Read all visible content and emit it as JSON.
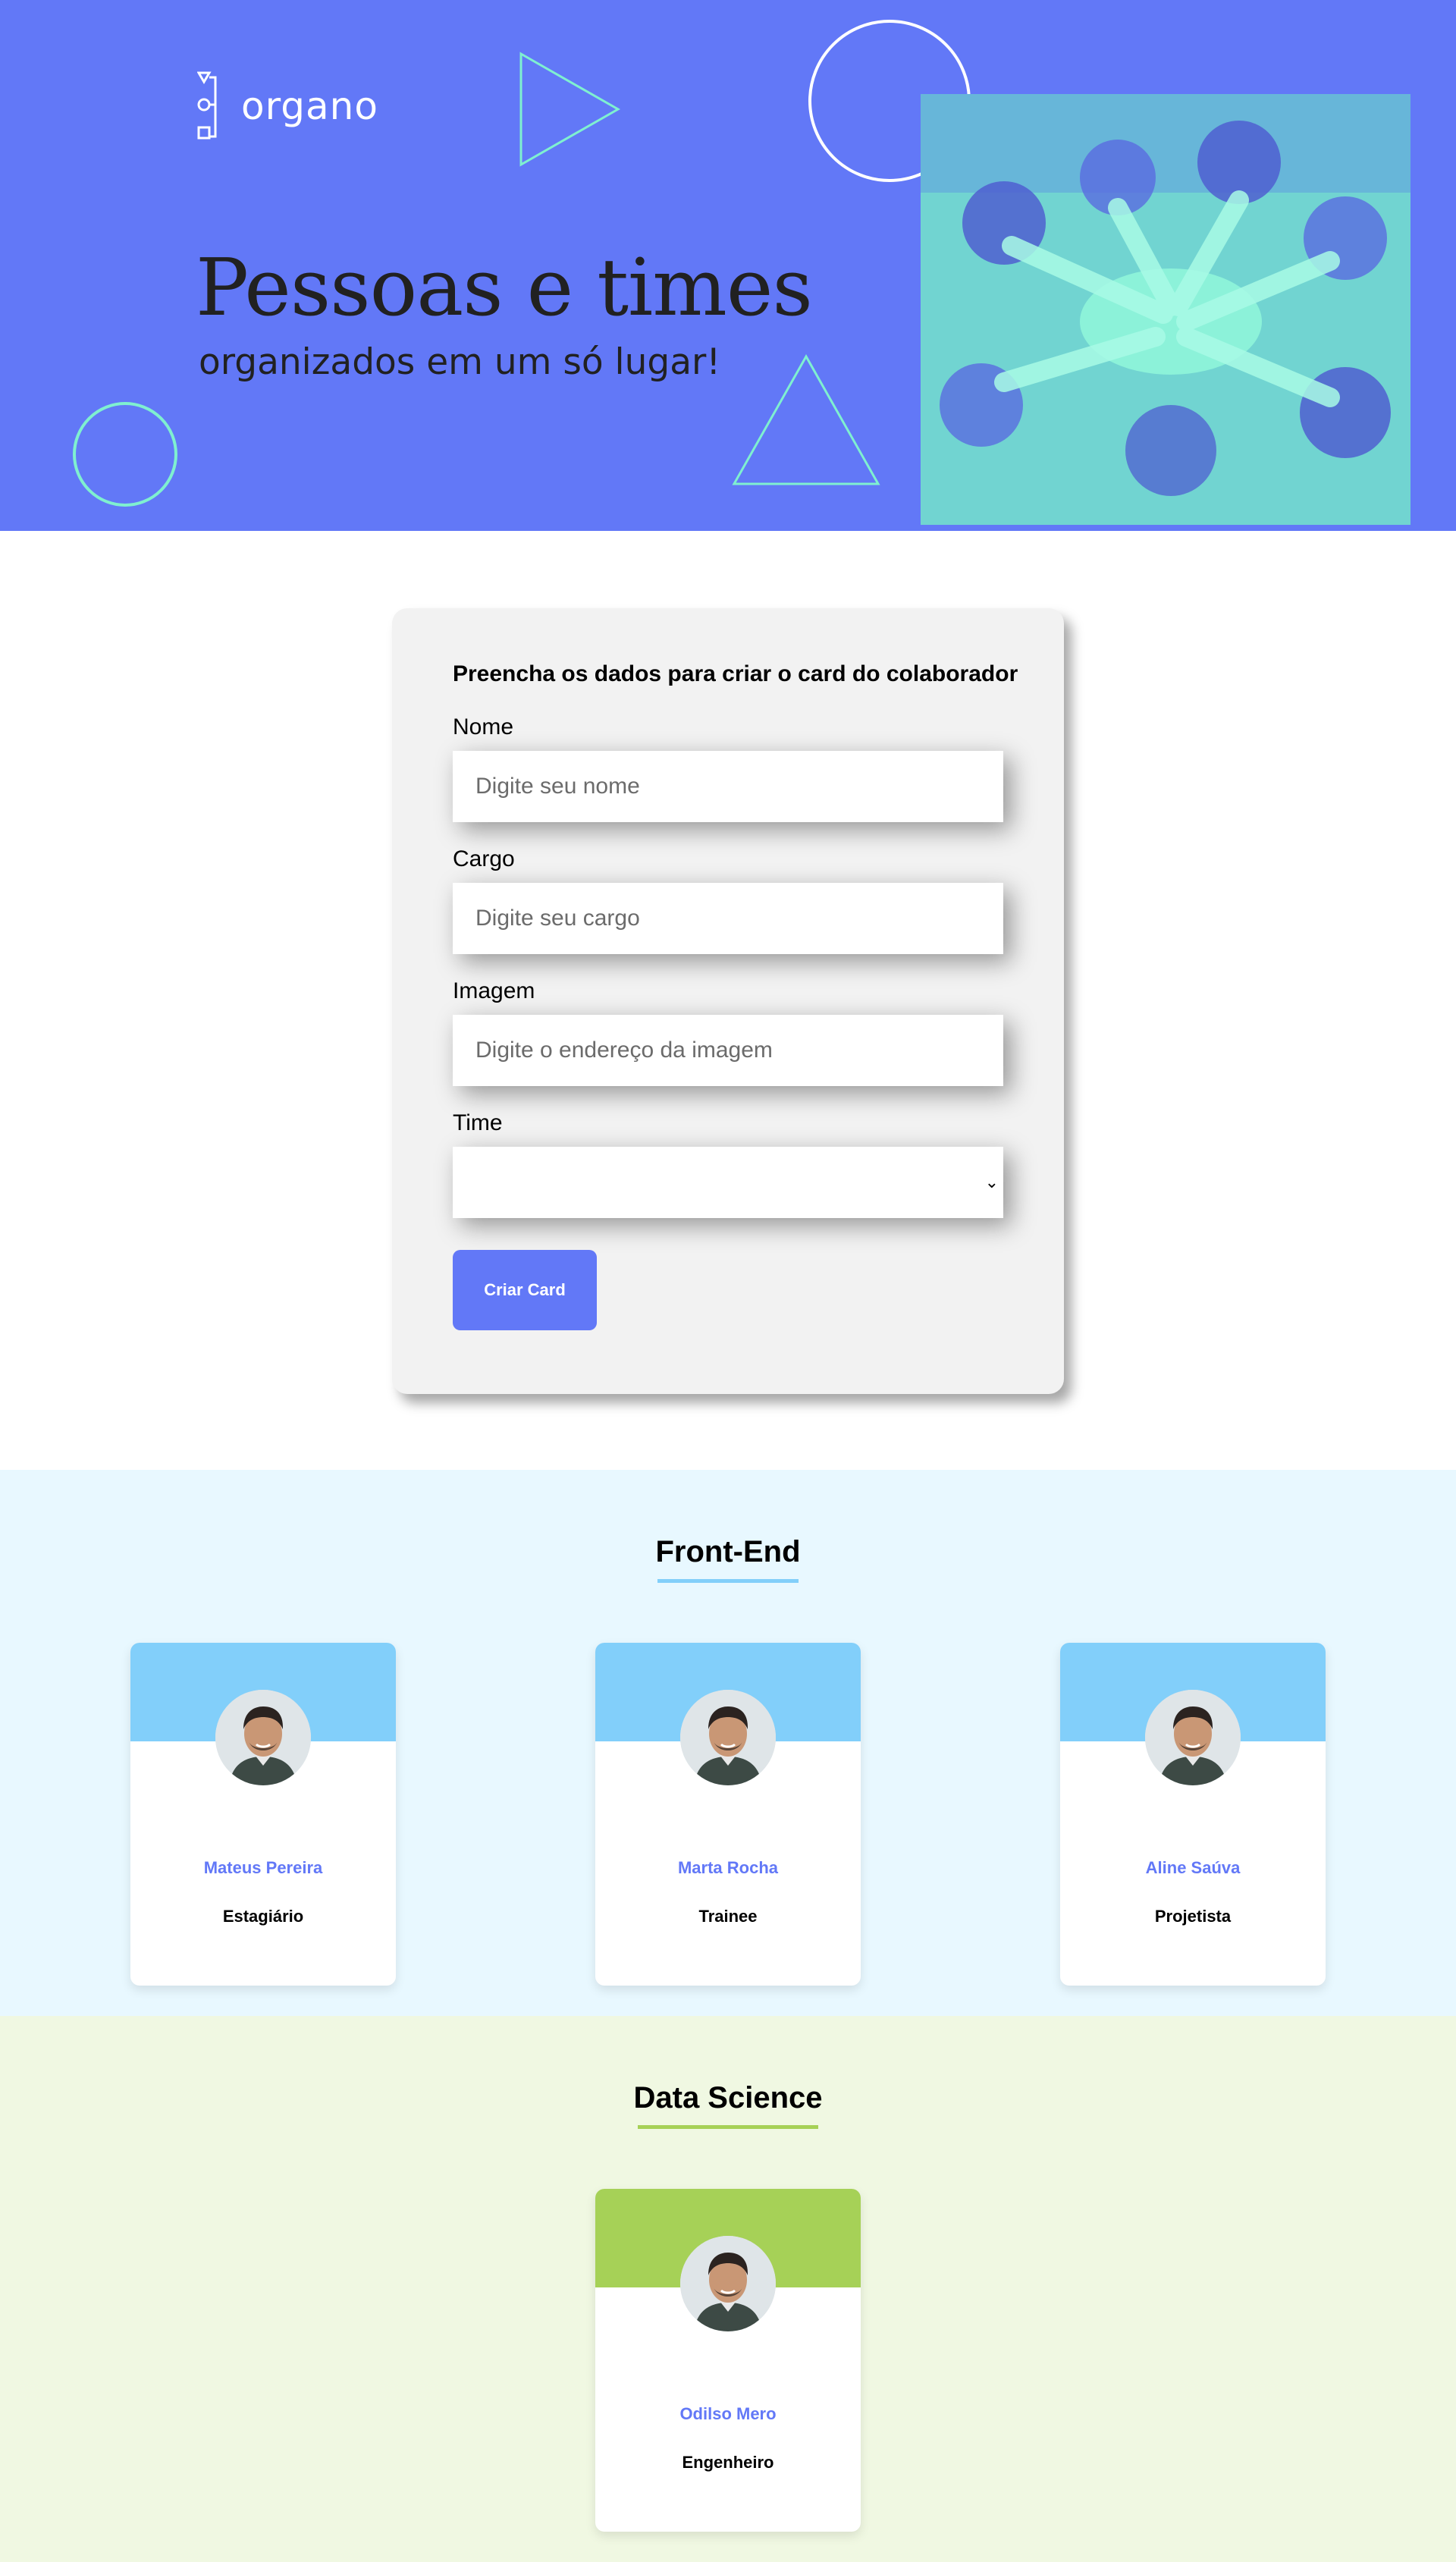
{
  "colors": {
    "hero_bg": "#6278f7",
    "photo_tint": "#7ff0d0",
    "accent": "#6278f7",
    "frontend_primary": "#82cffa",
    "frontend_secondary": "#e8f8ff",
    "data_primary": "#a6d157",
    "data_secondary": "#f0f8e2"
  },
  "hero": {
    "logo_text": "organo",
    "title": "Pessoas e times",
    "subtitle": "organizados em um só lugar!"
  },
  "form": {
    "title": "Preencha os dados para criar o card do colaborador",
    "fields": [
      {
        "label": "Nome",
        "placeholder": "Digite seu nome"
      },
      {
        "label": "Cargo",
        "placeholder": "Digite seu cargo"
      },
      {
        "label": "Imagem",
        "placeholder": "Digite o endereço da imagem"
      },
      {
        "label": "Time",
        "value": "",
        "chevron": "⌄"
      }
    ],
    "submit_label": "Criar Card"
  },
  "teams": [
    {
      "name": "Front-End",
      "members": [
        {
          "name": "Mateus Pereira",
          "role": "Estagiário"
        },
        {
          "name": "Marta Rocha",
          "role": "Trainee"
        },
        {
          "name": "Aline Saúva",
          "role": "Projetista"
        }
      ]
    },
    {
      "name": "Data Science",
      "members": [
        {
          "name": "Odilso Mero",
          "role": "Engenheiro"
        }
      ]
    }
  ]
}
